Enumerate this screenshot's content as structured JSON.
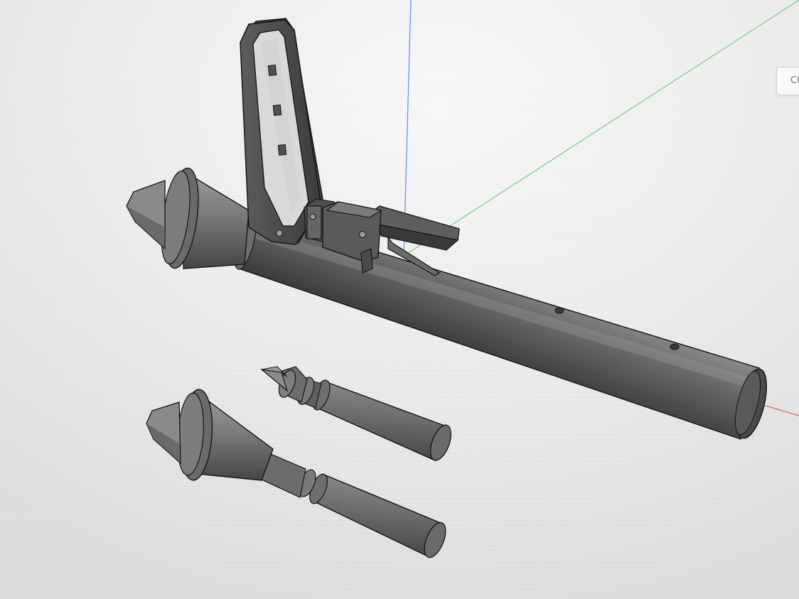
{
  "corner_tab": {
    "label": "Ct"
  },
  "scene": {
    "background_color": "#ececec",
    "grid_color": "#c9c9c9",
    "model_color": "#5a5a5a",
    "outline_color": "#161616",
    "axes": {
      "x_color": "#e06666",
      "y_color": "#7fcc7f",
      "z_color": "#5b8de8"
    },
    "objects": [
      {
        "name": "launcher-tube",
        "icon": "tube-with-warhead"
      },
      {
        "name": "rear-sight",
        "icon": "sight-frame"
      },
      {
        "name": "grip-trigger",
        "icon": "trigger-block"
      },
      {
        "name": "rocket-part",
        "icon": "cone-shaft"
      },
      {
        "name": "rocket-assembly",
        "icon": "warhead-shaft"
      }
    ]
  }
}
